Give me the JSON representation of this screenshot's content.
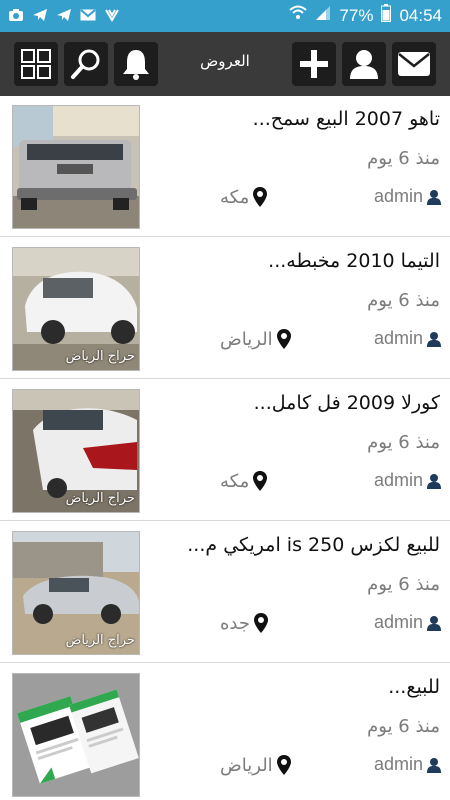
{
  "status_bar": {
    "battery": "77%",
    "time": "04:54",
    "icons": [
      "photo-icon",
      "telegram-icon",
      "telegram-icon",
      "gmail-icon",
      "app-icon",
      "wifi-icon",
      "signal-icon",
      "battery-icon"
    ]
  },
  "header": {
    "title": "العروض",
    "icons": [
      "grid-icon",
      "search-icon",
      "bell-icon",
      "plus-icon",
      "user-icon",
      "mail-icon"
    ]
  },
  "listings": [
    {
      "title": "تاهو 2007 البيع سمح...",
      "time": "منذ 6 يوم",
      "author": "admin",
      "city": "مكه",
      "watermark": ""
    },
    {
      "title": "التيما 2010 مخبطه...",
      "time": "منذ 6 يوم",
      "author": "admin",
      "city": "الرياض",
      "watermark": "حراج الرياض"
    },
    {
      "title": "كورلا 2009 فل كامل...",
      "time": "منذ 6 يوم",
      "author": "admin",
      "city": "مكه",
      "watermark": "حراج الرياض"
    },
    {
      "title": "للبيع لكزس 250 is امريكي م...",
      "time": "منذ 6 يوم",
      "author": "admin",
      "city": "جده",
      "watermark": "حراج الرياض"
    },
    {
      "title": "للبيع...",
      "time": "منذ 6 يوم",
      "author": "admin",
      "city": "الرياض",
      "watermark": ""
    }
  ],
  "colors": {
    "status_bar": "#36a0cc",
    "app_bar": "#3a3a3a",
    "button_bg": "#1d1d1d",
    "meta_text": "#7c7c7c"
  }
}
